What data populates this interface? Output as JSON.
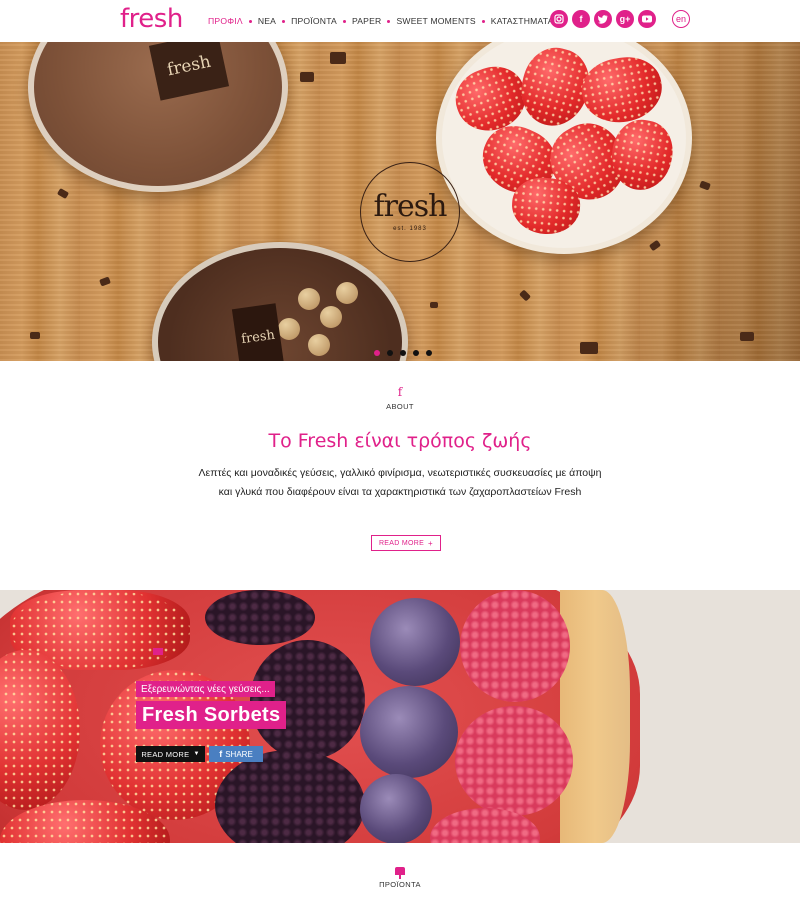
{
  "brand": {
    "logo_text": "fresh",
    "accent_color": "#e0218a"
  },
  "nav": {
    "items": [
      {
        "label": "ΠΡΟΦΙΛ",
        "active": true
      },
      {
        "label": "ΝΕΑ",
        "active": false
      },
      {
        "label": "ΠΡΟΪΟΝΤΑ",
        "active": false
      },
      {
        "label": "PAPER",
        "active": false
      },
      {
        "label": "SWEET MOMENTS",
        "active": false
      },
      {
        "label": "ΚΑΤΑΣΤΗΜΑΤΑ",
        "active": false
      }
    ],
    "socials": [
      "instagram-icon",
      "facebook-icon",
      "twitter-icon",
      "google-plus-icon",
      "youtube-icon"
    ],
    "language": "en"
  },
  "hero": {
    "jar_tag": "fresh",
    "bowl_tag": "fresh",
    "stamp_word": "fresh",
    "stamp_sub": "est. 1983",
    "slides": 5,
    "active_slide": 0
  },
  "about": {
    "icon": "f",
    "label": "ABOUT",
    "title": "Το Fresh είναι τρόπος ζωής",
    "text": "Λεπτές και μοναδικές γεύσεις, γαλλικό φινίρισμα, νεωτεριστικές συσκευασίες με άποψη και γλυκά που διαφέρουν είναι τα χαρακτηριστικά των ζαχαροπλαστείων Fresh",
    "read_more": "READ MORE"
  },
  "banner": {
    "kicker": "Εξερευνώντας νέες γεύσεις...",
    "title": "Fresh Sorbets",
    "read_more": "READ MORE",
    "share": "SHARE"
  },
  "products": {
    "label": "ΠΡΟΪΟΝΤΑ"
  }
}
